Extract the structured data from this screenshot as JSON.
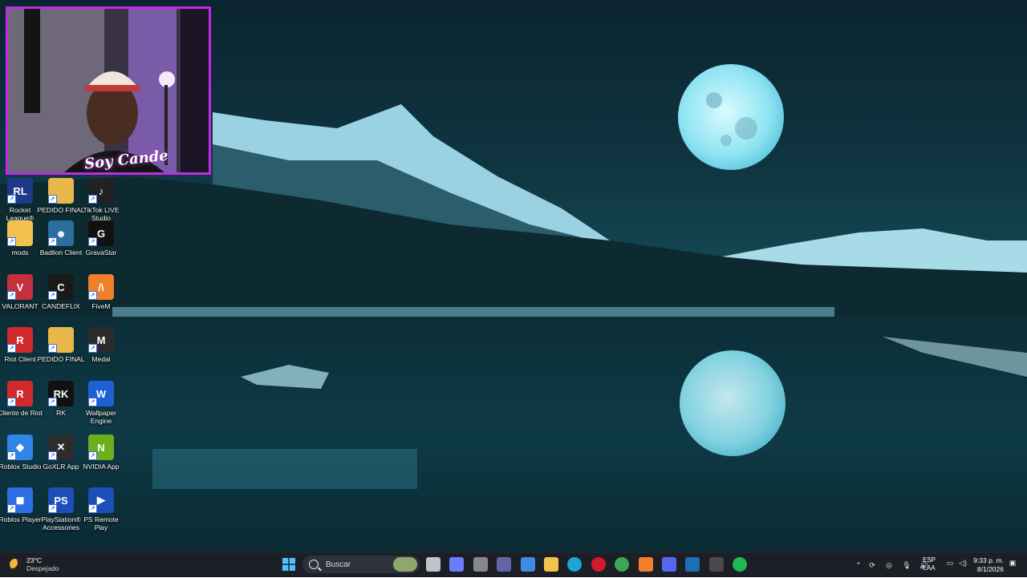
{
  "desktop": {
    "icons": [
      {
        "label": "Rocket League®",
        "color": "#1d3a8a",
        "glyph": "RL"
      },
      {
        "label": "PEDIDO FINAL",
        "color": "#e8b94a",
        "glyph": ""
      },
      {
        "label": "TikTok LIVE Studio",
        "color": "#222222",
        "glyph": "♪"
      },
      {
        "label": "mods",
        "color": "#f2c14e",
        "glyph": ""
      },
      {
        "label": "Badlion Client",
        "color": "#2a6f9e",
        "glyph": "☻"
      },
      {
        "label": "GravaStar",
        "color": "#111111",
        "glyph": "G"
      },
      {
        "label": "VALORANT",
        "color": "#c4303c",
        "glyph": "V"
      },
      {
        "label": "CANDEFLIX",
        "color": "#1a1a1a",
        "glyph": "C"
      },
      {
        "label": "FiveM",
        "color": "#f2802b",
        "glyph": "/\\"
      },
      {
        "label": "Riot Client",
        "color": "#d22a2a",
        "glyph": "R"
      },
      {
        "label": "PEDIDO FINAL",
        "color": "#e8b94a",
        "glyph": ""
      },
      {
        "label": "Medal",
        "color": "#2b2b2b",
        "glyph": "M"
      },
      {
        "label": "Cliente de Riot",
        "color": "#d22a2a",
        "glyph": "R"
      },
      {
        "label": "RK",
        "color": "#111111",
        "glyph": "RK"
      },
      {
        "label": "Wallpaper Engine",
        "color": "#1e5fd6",
        "glyph": "W"
      },
      {
        "label": "Roblox Studio",
        "color": "#2f86e6",
        "glyph": "◆"
      },
      {
        "label": "GoXLR App",
        "color": "#2d2d2d",
        "glyph": "✕"
      },
      {
        "label": "NVIDIA App",
        "color": "#6cae1c",
        "glyph": "N"
      },
      {
        "label": "Roblox Player",
        "color": "#2f6fe6",
        "glyph": "◼"
      },
      {
        "label": "PlayStation® Accessories",
        "color": "#1c4fb8",
        "glyph": "PS"
      },
      {
        "label": "PS Remote Play",
        "color": "#1c4fb8",
        "glyph": "▶"
      }
    ]
  },
  "webcam": {
    "caption": "Soy Cande"
  },
  "taskbar": {
    "weather": {
      "temp": "23°C",
      "condition": "Despejado"
    },
    "search_placeholder": "Buscar",
    "apps": [
      {
        "name": "task-view-icon",
        "color": "#bfc4cc"
      },
      {
        "name": "copilot-icon",
        "color": "#6b7dff"
      },
      {
        "name": "winamp-icon",
        "color": "#888888"
      },
      {
        "name": "teams-icon",
        "color": "#6264a7"
      },
      {
        "name": "store-icon",
        "color": "#3a8de0"
      },
      {
        "name": "file-explorer-icon",
        "color": "#f2c14e"
      },
      {
        "name": "edge-icon",
        "color": "#1fa3d9"
      },
      {
        "name": "opera-icon",
        "color": "#d31a2b"
      },
      {
        "name": "chrome-icon",
        "color": "#3aa757"
      },
      {
        "name": "fivem-icon",
        "color": "#f2802b"
      },
      {
        "name": "discord-icon",
        "color": "#5865f2"
      },
      {
        "name": "steam-icon",
        "color": "#1b6fb5"
      },
      {
        "name": "obs-icon",
        "color": "#4a4a4a"
      },
      {
        "name": "spotify-icon",
        "color": "#1db954"
      }
    ],
    "tray": {
      "language": "ESP",
      "layout": "LAA",
      "time": "9:33 p. m.",
      "date": "8/1/2026"
    }
  }
}
